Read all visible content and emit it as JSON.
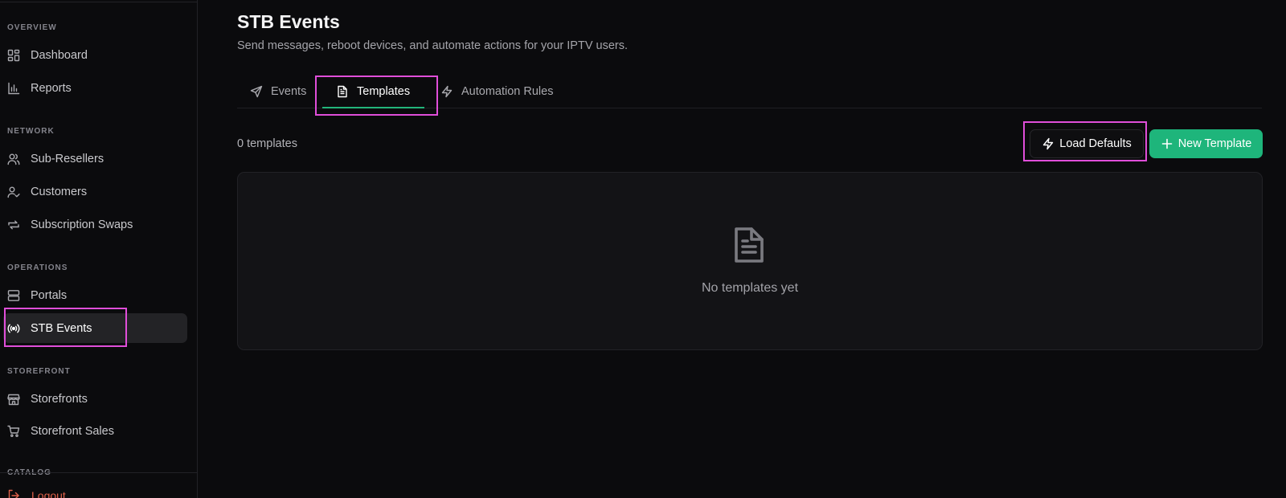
{
  "sidebar": {
    "sections": {
      "overview": "OVERVIEW",
      "network": "NETWORK",
      "operations": "OPERATIONS",
      "storefront": "STOREFRONT",
      "catalog": "CATALOG"
    },
    "items": {
      "dashboard": "Dashboard",
      "reports": "Reports",
      "sub_resellers": "Sub-Resellers",
      "customers": "Customers",
      "subscription_swaps": "Subscription Swaps",
      "portals": "Portals",
      "stb_events": "STB Events",
      "storefronts": "Storefronts",
      "storefront_sales": "Storefront Sales"
    },
    "active_item": "STB Events",
    "logout": "Logout"
  },
  "header": {
    "title": "STB Events",
    "subtitle": "Send messages, reboot devices, and automate actions for your IPTV users."
  },
  "tabs": [
    {
      "label": "Events",
      "icon": "send-icon"
    },
    {
      "label": "Templates",
      "icon": "file-text-icon",
      "active": true
    },
    {
      "label": "Automation Rules",
      "icon": "zap-icon"
    }
  ],
  "toolbar": {
    "count": "0 templates",
    "load_defaults": "Load Defaults",
    "new_template": "New Template"
  },
  "empty_state": {
    "icon": "file-text-icon",
    "message": "No templates yet"
  },
  "colors": {
    "accent": "#1eb57b",
    "background": "#0b0b0d",
    "highlight": "#e04ed9",
    "danger": "#e0604a"
  }
}
